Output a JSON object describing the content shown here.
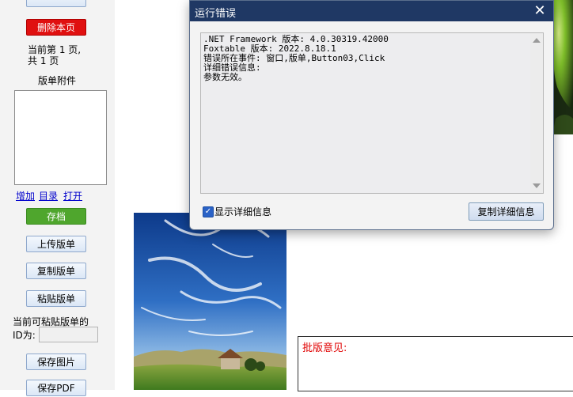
{
  "left_panel": {
    "delete_page_label": "删除本页",
    "page_info_line1": "当前第 1 页,",
    "page_info_line2": "共 1 页",
    "attachments_label": "版单附件",
    "links": [
      "增加",
      "目录",
      "打开"
    ],
    "archive_label": "存档",
    "upload_label": "上传版单",
    "copy_label": "复制版单",
    "paste_label": "粘贴版单",
    "paste_id_line1": "当前可粘贴版单的",
    "paste_id_line2": "ID为:",
    "paste_id_value": "",
    "save_image_label": "保存图片",
    "save_pdf_label": "保存PDF"
  },
  "main": {
    "comment_label": "批版意见:"
  },
  "dialog": {
    "title": "运行错误",
    "close_symbol": "✕",
    "error_lines": [
      ".NET Framework 版本: 4.0.30319.42000",
      "Foxtable 版本: 2022.8.18.1",
      "错误所在事件: 窗口,版单,Button03,Click",
      "详细错误信息:",
      "参数无效。"
    ],
    "show_details_label": "显示详细信息",
    "show_details_checked": true,
    "copy_details_label": "复制详细信息"
  },
  "colors": {
    "titlebar": "#1f3864",
    "delete_button": "#e01010",
    "archive_button": "#4fa62d",
    "comment_label": "#e00000",
    "link": "#0000cc"
  }
}
